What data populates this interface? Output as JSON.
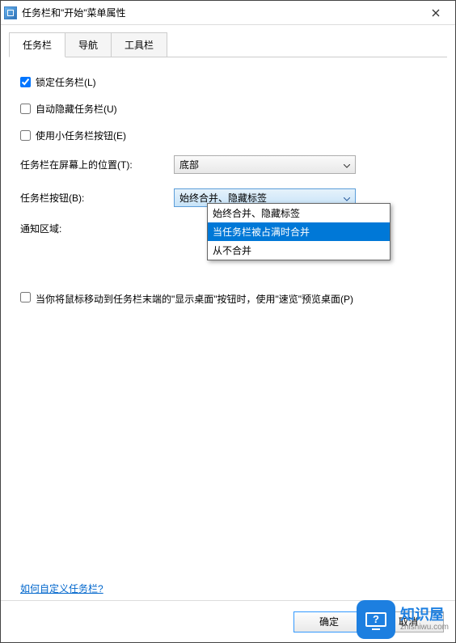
{
  "window": {
    "title": "任务栏和\"开始\"菜单属性"
  },
  "tabs": {
    "items": [
      {
        "label": "任务栏",
        "active": true
      },
      {
        "label": "导航",
        "active": false
      },
      {
        "label": "工具栏",
        "active": false
      }
    ]
  },
  "checkboxes": {
    "lock": {
      "label": "锁定任务栏(L)",
      "checked": true
    },
    "autohide": {
      "label": "自动隐藏任务栏(U)",
      "checked": false
    },
    "smallbuttons": {
      "label": "使用小任务栏按钮(E)",
      "checked": false
    },
    "peek": {
      "label": "当你将鼠标移动到任务栏末端的\"显示桌面\"按钮时，使用\"速览\"预览桌面(P)",
      "checked": false
    }
  },
  "labels": {
    "position": "任务栏在屏幕上的位置(T):",
    "buttons": "任务栏按钮(B):",
    "notify": "通知区域:"
  },
  "combos": {
    "position": {
      "value": "底部"
    },
    "buttons": {
      "value": "始终合并、隐藏标签"
    }
  },
  "dropdown": {
    "items": [
      {
        "label": "始终合并、隐藏标签",
        "highlight": false
      },
      {
        "label": "当任务栏被占满时合并",
        "highlight": true
      },
      {
        "label": "从不合并",
        "highlight": false
      }
    ]
  },
  "help_link": "如何自定义任务栏?",
  "buttons_bar": {
    "ok": "确定",
    "cancel": "取消",
    "apply_partial": "取"
  },
  "watermark": {
    "brand": "知识屋",
    "url": "zhishiwu.com"
  }
}
